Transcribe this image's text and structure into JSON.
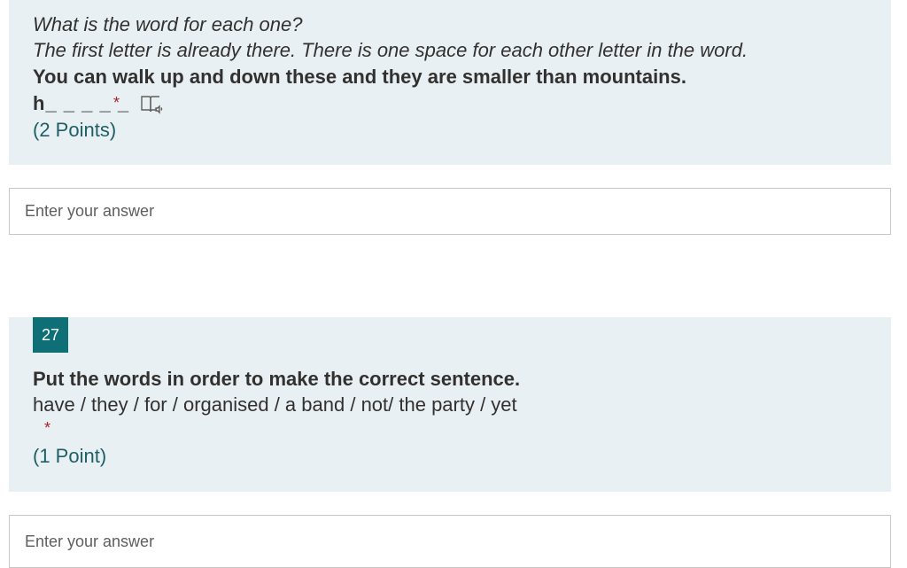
{
  "question26": {
    "instruction_1": "What is the word for each one?",
    "instruction_2": "The first letter is already there. There is one space for each other letter in the word.",
    "prompt": "You can walk up and down these and they are smaller than mountains.",
    "blank": "h_ _ _ _ _",
    "required_mark": "*",
    "points": "(2 Points)",
    "icon": "immersive-reader-icon",
    "answer_placeholder": "Enter your answer",
    "answer_value": ""
  },
  "question27": {
    "number": "27",
    "prompt": "Put the words in order to make the correct sentence.",
    "words": "have / they / for / organised / a band / not/ the party / yet",
    "required_mark": "*",
    "points": "(1 Point)",
    "answer_placeholder": "Enter your answer",
    "answer_value": ""
  },
  "colors": {
    "question_background": "#e8f0f3",
    "number_badge": "#0f6f76",
    "required": "#a4262c",
    "points_text": "#1d5f64"
  }
}
